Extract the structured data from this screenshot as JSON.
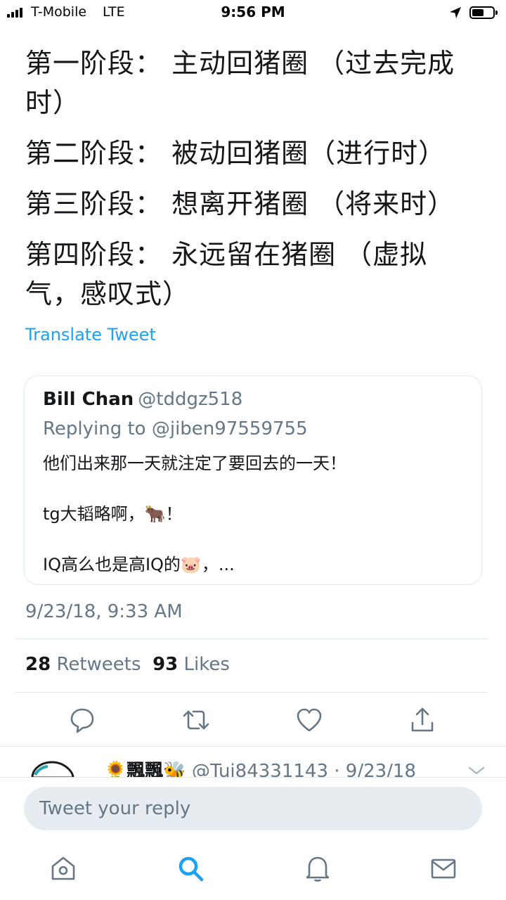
{
  "status_bar": {
    "carrier": "T-Mobile",
    "network": "LTE",
    "time": "9:56 PM"
  },
  "tweet": {
    "lines": [
      "第一阶段： 主动回猪圈 （过去完成时）",
      "第二阶段： 被动回猪圈（进行时）",
      "第三阶段： 想离开猪圈 （将来时）",
      "第四阶段： 永远留在猪圈 （虚拟气，感叹式）"
    ],
    "translate_label": "Translate Tweet"
  },
  "quoted_tweet": {
    "name": "Bill Chan",
    "handle": "@tddgz518",
    "replying_to": "Replying to @jiben97559755",
    "lines": [
      "他们出来那一天就注定了要回去的一天！",
      "tg大韬略啊，🐂！",
      "IQ高么也是高IQ的🐷，..."
    ]
  },
  "timestamp": "9/23/18, 9:33 AM",
  "stats": {
    "retweets_count": "28",
    "retweets_label": "Retweets",
    "likes_count": "93",
    "likes_label": "Likes"
  },
  "reply_preview": {
    "name": "🌻飄飄🐝",
    "handle_time": "@Tui84331143 · 9/23/18"
  },
  "compose": {
    "placeholder": "Tweet your reply"
  },
  "colors": {
    "accent": "#1da1f2",
    "text": "#14171a",
    "secondary": "#657786",
    "border": "#e1e8ed",
    "input_bg": "#e6ecf0"
  },
  "icons": {
    "actions": [
      "reply-icon",
      "retweet-icon",
      "like-icon",
      "share-icon"
    ],
    "tabs": [
      "home-icon",
      "search-icon",
      "notifications-icon",
      "messages-icon"
    ]
  }
}
